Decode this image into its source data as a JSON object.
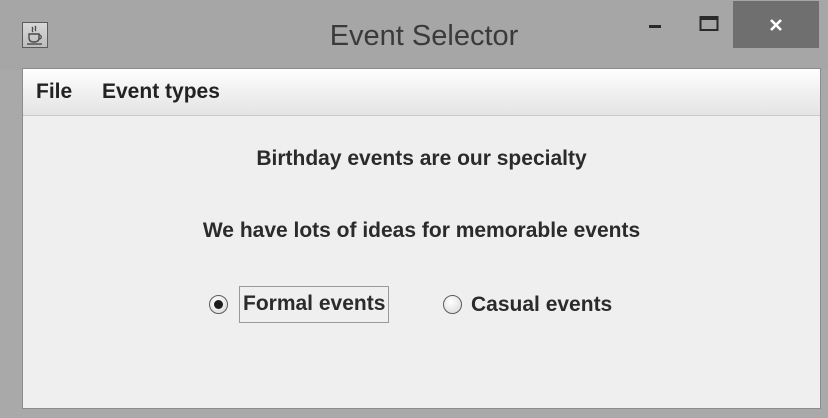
{
  "window": {
    "title": "Event Selector",
    "minimize_glyph": "–",
    "maximize_glyph": "□",
    "close_glyph": "✕"
  },
  "menubar": {
    "items": [
      {
        "label": "File"
      },
      {
        "label": "Event types"
      }
    ]
  },
  "content": {
    "line1": "Birthday events are our specialty",
    "line2": "We have lots of ideas for memorable events"
  },
  "radio_group": {
    "options": [
      {
        "label": "Formal events",
        "selected": true,
        "focused": true
      },
      {
        "label": "Casual events",
        "selected": false,
        "focused": false
      }
    ]
  },
  "colors": {
    "window_frame": "#a9a9a9",
    "close_button": "#6f6f6f",
    "content_background": "#efefef"
  },
  "icons": {
    "app": "java-cup-icon",
    "minimize": "minimize-icon",
    "maximize": "maximize-icon",
    "close": "close-icon"
  }
}
